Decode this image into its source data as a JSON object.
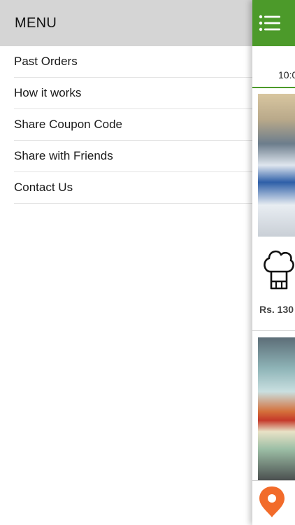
{
  "menu": {
    "title": "MENU",
    "items": [
      {
        "label": "Past Orders"
      },
      {
        "label": "How it works"
      },
      {
        "label": "Share Coupon Code"
      },
      {
        "label": "Share with Friends"
      },
      {
        "label": "Contact Us"
      }
    ]
  },
  "panel": {
    "time_text": "10:0",
    "price_text": "Rs. 130"
  },
  "colors": {
    "brand_green": "#4c9a2a",
    "menu_header_bg": "#d5d5d5",
    "pin_orange": "#f26b2a"
  },
  "icons": {
    "hamburger": "hamburger-menu-icon",
    "chef": "chef-hat-icon",
    "pin": "location-pin-icon"
  }
}
